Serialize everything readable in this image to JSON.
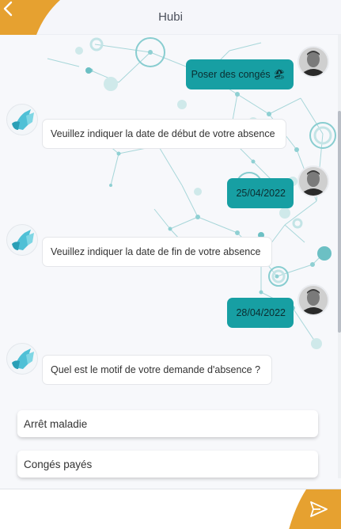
{
  "header": {
    "title": "Hubi",
    "accent_color": "#e6a130",
    "back_icon": "chevron-left-icon"
  },
  "messages": [
    {
      "from": "user",
      "text": "Poser des congés 🏖"
    },
    {
      "from": "bot",
      "text": "Veuillez indiquer la date de début de votre absence"
    },
    {
      "from": "user",
      "text": "25/04/2022"
    },
    {
      "from": "bot",
      "text": "Veuillez indiquer la date de fin de votre absence"
    },
    {
      "from": "user",
      "text": "28/04/2022"
    },
    {
      "from": "bot",
      "text": "Quel est le motif de votre demande d'absence ?"
    }
  ],
  "choices": [
    {
      "label": "Arrêt maladie"
    },
    {
      "label": "Congés payés"
    }
  ],
  "composer": {
    "placeholder": "",
    "send_icon": "send-icon"
  },
  "colors": {
    "user_bubble": "#179fa3",
    "bot_bubble": "#ffffff",
    "network": "#39a9ad"
  }
}
